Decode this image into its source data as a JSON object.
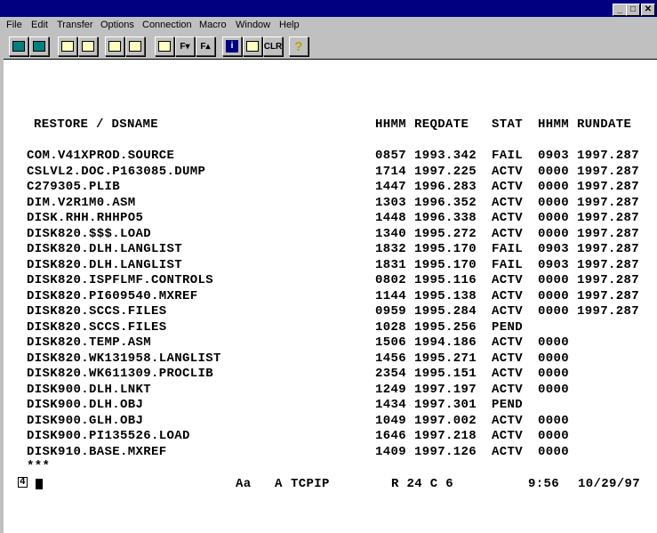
{
  "window": {
    "minimize": "_",
    "maximize": "□",
    "close": "✕"
  },
  "menu": [
    "File",
    "Edit",
    "Transfer",
    "Options",
    "Connection",
    "Macro",
    "Window",
    "Help"
  ],
  "toolbar": [
    {
      "icon": "display-icon",
      "label": ""
    },
    {
      "icon": "print-icon",
      "label": ""
    },
    {
      "icon": "copy-icon",
      "label": ""
    },
    {
      "icon": "paste-icon",
      "label": ""
    },
    {
      "icon": "send-file-icon",
      "label": ""
    },
    {
      "icon": "receive-file-icon",
      "label": ""
    },
    {
      "icon": "printer-setup-icon",
      "label": ""
    },
    {
      "icon": "font-down-icon",
      "label": "F▾"
    },
    {
      "icon": "font-up-icon",
      "label": "F▴"
    },
    {
      "icon": "info-icon",
      "label": "i"
    },
    {
      "icon": "notes-icon",
      "label": ""
    },
    {
      "icon": "clear-icon",
      "label": "CLR"
    },
    {
      "icon": "help-icon",
      "label": "?"
    }
  ],
  "header": {
    "dsname": "RESTORE / DSNAME",
    "hhmm": "HHMM",
    "reqdate": "REQDATE",
    "stat": "STAT",
    "hhmm2": "HHMM",
    "rundate": "RUNDATE"
  },
  "rows": [
    [
      "COM.V41XPROD.SOURCE",
      "0857",
      "1993.342",
      "FAIL",
      "0903",
      "1997.287"
    ],
    [
      "CSLVL2.DOC.P163085.DUMP",
      "1714",
      "1997.225",
      "ACTV",
      "0000",
      "1997.287"
    ],
    [
      "C279305.PLIB",
      "1447",
      "1996.283",
      "ACTV",
      "0000",
      "1997.287"
    ],
    [
      "DIM.V2R1M0.ASM",
      "1303",
      "1996.352",
      "ACTV",
      "0000",
      "1997.287"
    ],
    [
      "DISK.RHH.RHHPO5",
      "1448",
      "1996.338",
      "ACTV",
      "0000",
      "1997.287"
    ],
    [
      "DISK820.$$$.LOAD",
      "1340",
      "1995.272",
      "ACTV",
      "0000",
      "1997.287"
    ],
    [
      "DISK820.DLH.LANGLIST",
      "1832",
      "1995.170",
      "FAIL",
      "0903",
      "1997.287"
    ],
    [
      "DISK820.DLH.LANGLIST",
      "1831",
      "1995.170",
      "FAIL",
      "0903",
      "1997.287"
    ],
    [
      "DISK820.ISPFLMF.CONTROLS",
      "0802",
      "1995.116",
      "ACTV",
      "0000",
      "1997.287"
    ],
    [
      "DISK820.PI609540.MXREF",
      "1144",
      "1995.138",
      "ACTV",
      "0000",
      "1997.287"
    ],
    [
      "DISK820.SCCS.FILES",
      "0959",
      "1995.284",
      "ACTV",
      "0000",
      "1997.287"
    ],
    [
      "DISK820.SCCS.FILES",
      "1028",
      "1995.256",
      "PEND",
      "",
      ""
    ],
    [
      "DISK820.TEMP.ASM",
      "1506",
      "1994.186",
      "ACTV",
      "0000",
      ""
    ],
    [
      "DISK820.WK131958.LANGLIST",
      "1456",
      "1995.271",
      "ACTV",
      "0000",
      ""
    ],
    [
      "DISK820.WK611309.PROCLIB",
      "2354",
      "1995.151",
      "ACTV",
      "0000",
      ""
    ],
    [
      "DISK900.DLH.LNKT",
      "1249",
      "1997.197",
      "ACTV",
      "0000",
      ""
    ],
    [
      "DISK900.DLH.OBJ",
      "1434",
      "1997.301",
      "PEND",
      "",
      ""
    ],
    [
      "DISK900.GLH.OBJ",
      "1049",
      "1997.002",
      "ACTV",
      "0000",
      ""
    ],
    [
      "DISK900.PI135526.LOAD",
      "1646",
      "1997.218",
      "ACTV",
      "0000",
      ""
    ],
    [
      "DISK910.BASE.MXREF",
      "1409",
      "1997.126",
      "ACTV",
      "0000",
      ""
    ]
  ],
  "end_marker": "***",
  "status": {
    "session": "4",
    "font": "Aa",
    "mode": "A",
    "connection": "TCPIP",
    "cursor_pos": "R 24 C 6",
    "time": "9:56",
    "date": "10/29/97"
  }
}
